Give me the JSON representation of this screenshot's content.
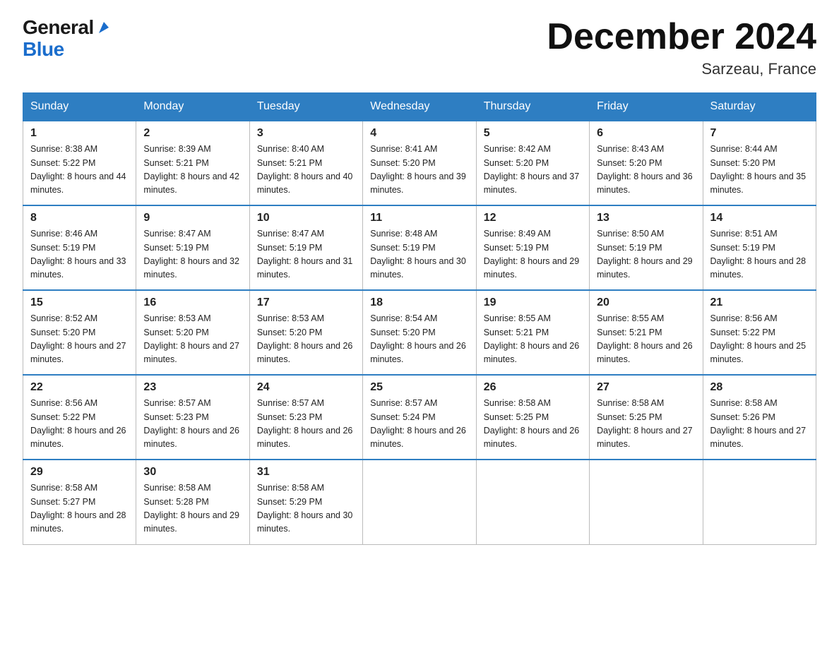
{
  "header": {
    "logo_general": "General",
    "logo_blue": "Blue",
    "title": "December 2024",
    "subtitle": "Sarzeau, France"
  },
  "calendar": {
    "days_of_week": [
      "Sunday",
      "Monday",
      "Tuesday",
      "Wednesday",
      "Thursday",
      "Friday",
      "Saturday"
    ],
    "weeks": [
      [
        {
          "date": "1",
          "sunrise": "8:38 AM",
          "sunset": "5:22 PM",
          "daylight": "8 hours and 44 minutes."
        },
        {
          "date": "2",
          "sunrise": "8:39 AM",
          "sunset": "5:21 PM",
          "daylight": "8 hours and 42 minutes."
        },
        {
          "date": "3",
          "sunrise": "8:40 AM",
          "sunset": "5:21 PM",
          "daylight": "8 hours and 40 minutes."
        },
        {
          "date": "4",
          "sunrise": "8:41 AM",
          "sunset": "5:20 PM",
          "daylight": "8 hours and 39 minutes."
        },
        {
          "date": "5",
          "sunrise": "8:42 AM",
          "sunset": "5:20 PM",
          "daylight": "8 hours and 37 minutes."
        },
        {
          "date": "6",
          "sunrise": "8:43 AM",
          "sunset": "5:20 PM",
          "daylight": "8 hours and 36 minutes."
        },
        {
          "date": "7",
          "sunrise": "8:44 AM",
          "sunset": "5:20 PM",
          "daylight": "8 hours and 35 minutes."
        }
      ],
      [
        {
          "date": "8",
          "sunrise": "8:46 AM",
          "sunset": "5:19 PM",
          "daylight": "8 hours and 33 minutes."
        },
        {
          "date": "9",
          "sunrise": "8:47 AM",
          "sunset": "5:19 PM",
          "daylight": "8 hours and 32 minutes."
        },
        {
          "date": "10",
          "sunrise": "8:47 AM",
          "sunset": "5:19 PM",
          "daylight": "8 hours and 31 minutes."
        },
        {
          "date": "11",
          "sunrise": "8:48 AM",
          "sunset": "5:19 PM",
          "daylight": "8 hours and 30 minutes."
        },
        {
          "date": "12",
          "sunrise": "8:49 AM",
          "sunset": "5:19 PM",
          "daylight": "8 hours and 29 minutes."
        },
        {
          "date": "13",
          "sunrise": "8:50 AM",
          "sunset": "5:19 PM",
          "daylight": "8 hours and 29 minutes."
        },
        {
          "date": "14",
          "sunrise": "8:51 AM",
          "sunset": "5:19 PM",
          "daylight": "8 hours and 28 minutes."
        }
      ],
      [
        {
          "date": "15",
          "sunrise": "8:52 AM",
          "sunset": "5:20 PM",
          "daylight": "8 hours and 27 minutes."
        },
        {
          "date": "16",
          "sunrise": "8:53 AM",
          "sunset": "5:20 PM",
          "daylight": "8 hours and 27 minutes."
        },
        {
          "date": "17",
          "sunrise": "8:53 AM",
          "sunset": "5:20 PM",
          "daylight": "8 hours and 26 minutes."
        },
        {
          "date": "18",
          "sunrise": "8:54 AM",
          "sunset": "5:20 PM",
          "daylight": "8 hours and 26 minutes."
        },
        {
          "date": "19",
          "sunrise": "8:55 AM",
          "sunset": "5:21 PM",
          "daylight": "8 hours and 26 minutes."
        },
        {
          "date": "20",
          "sunrise": "8:55 AM",
          "sunset": "5:21 PM",
          "daylight": "8 hours and 26 minutes."
        },
        {
          "date": "21",
          "sunrise": "8:56 AM",
          "sunset": "5:22 PM",
          "daylight": "8 hours and 25 minutes."
        }
      ],
      [
        {
          "date": "22",
          "sunrise": "8:56 AM",
          "sunset": "5:22 PM",
          "daylight": "8 hours and 26 minutes."
        },
        {
          "date": "23",
          "sunrise": "8:57 AM",
          "sunset": "5:23 PM",
          "daylight": "8 hours and 26 minutes."
        },
        {
          "date": "24",
          "sunrise": "8:57 AM",
          "sunset": "5:23 PM",
          "daylight": "8 hours and 26 minutes."
        },
        {
          "date": "25",
          "sunrise": "8:57 AM",
          "sunset": "5:24 PM",
          "daylight": "8 hours and 26 minutes."
        },
        {
          "date": "26",
          "sunrise": "8:58 AM",
          "sunset": "5:25 PM",
          "daylight": "8 hours and 26 minutes."
        },
        {
          "date": "27",
          "sunrise": "8:58 AM",
          "sunset": "5:25 PM",
          "daylight": "8 hours and 27 minutes."
        },
        {
          "date": "28",
          "sunrise": "8:58 AM",
          "sunset": "5:26 PM",
          "daylight": "8 hours and 27 minutes."
        }
      ],
      [
        {
          "date": "29",
          "sunrise": "8:58 AM",
          "sunset": "5:27 PM",
          "daylight": "8 hours and 28 minutes."
        },
        {
          "date": "30",
          "sunrise": "8:58 AM",
          "sunset": "5:28 PM",
          "daylight": "8 hours and 29 minutes."
        },
        {
          "date": "31",
          "sunrise": "8:58 AM",
          "sunset": "5:29 PM",
          "daylight": "8 hours and 30 minutes."
        },
        null,
        null,
        null,
        null
      ]
    ]
  }
}
